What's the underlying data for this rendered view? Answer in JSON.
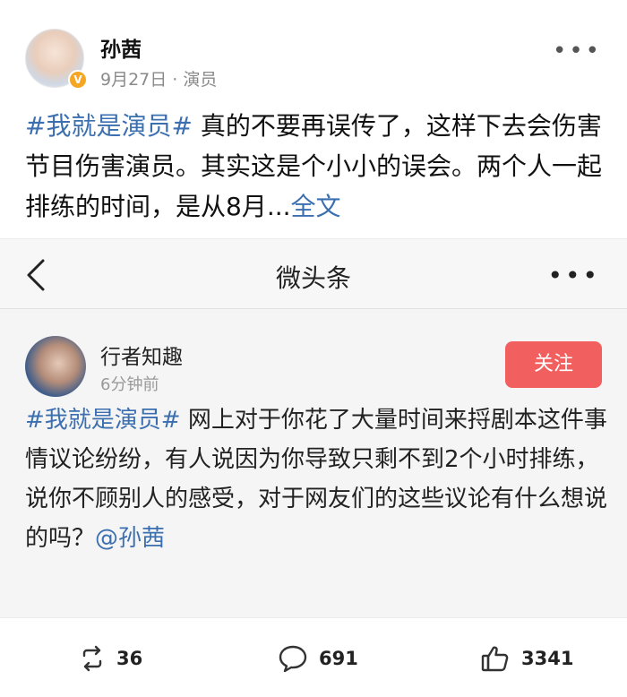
{
  "post": {
    "author": "孙茜",
    "date": "9月27日",
    "separator": " · ",
    "source": "演员",
    "text": {
      "hashtag": "#我就是演员#",
      "body": " 真的不要再误传了，这样下去会伤害节目伤害演员。其实这是个小小的误会。两个人一起排练的时间，是从8月...",
      "expand": "全文"
    }
  },
  "embedded": {
    "nav_title": "微头条",
    "author": "行者知趣",
    "time": "6分钟前",
    "follow_label": "关注",
    "hashtag": "#我就是演员#",
    "body": " 网上对于你花了大量时间来捋剧本这件事情议论纷纷，有人说因为你导致只剩不到2个小时排练，说你不顾别人的感受，对于网友们的这些议论有什么想说的吗？",
    "mention": "@孙茜"
  },
  "actions": {
    "reposts": "36",
    "comments": "691",
    "likes": "3341"
  },
  "icons": {
    "verified": "verified-badge-icon",
    "more": "more-dots-icon",
    "back": "chevron-left-icon",
    "repost": "repost-icon",
    "comment": "comment-icon",
    "like": "thumbs-up-icon"
  },
  "colors": {
    "link": "#3b6fb0",
    "follow": "#f25f5f",
    "verified": "#f5a623"
  }
}
